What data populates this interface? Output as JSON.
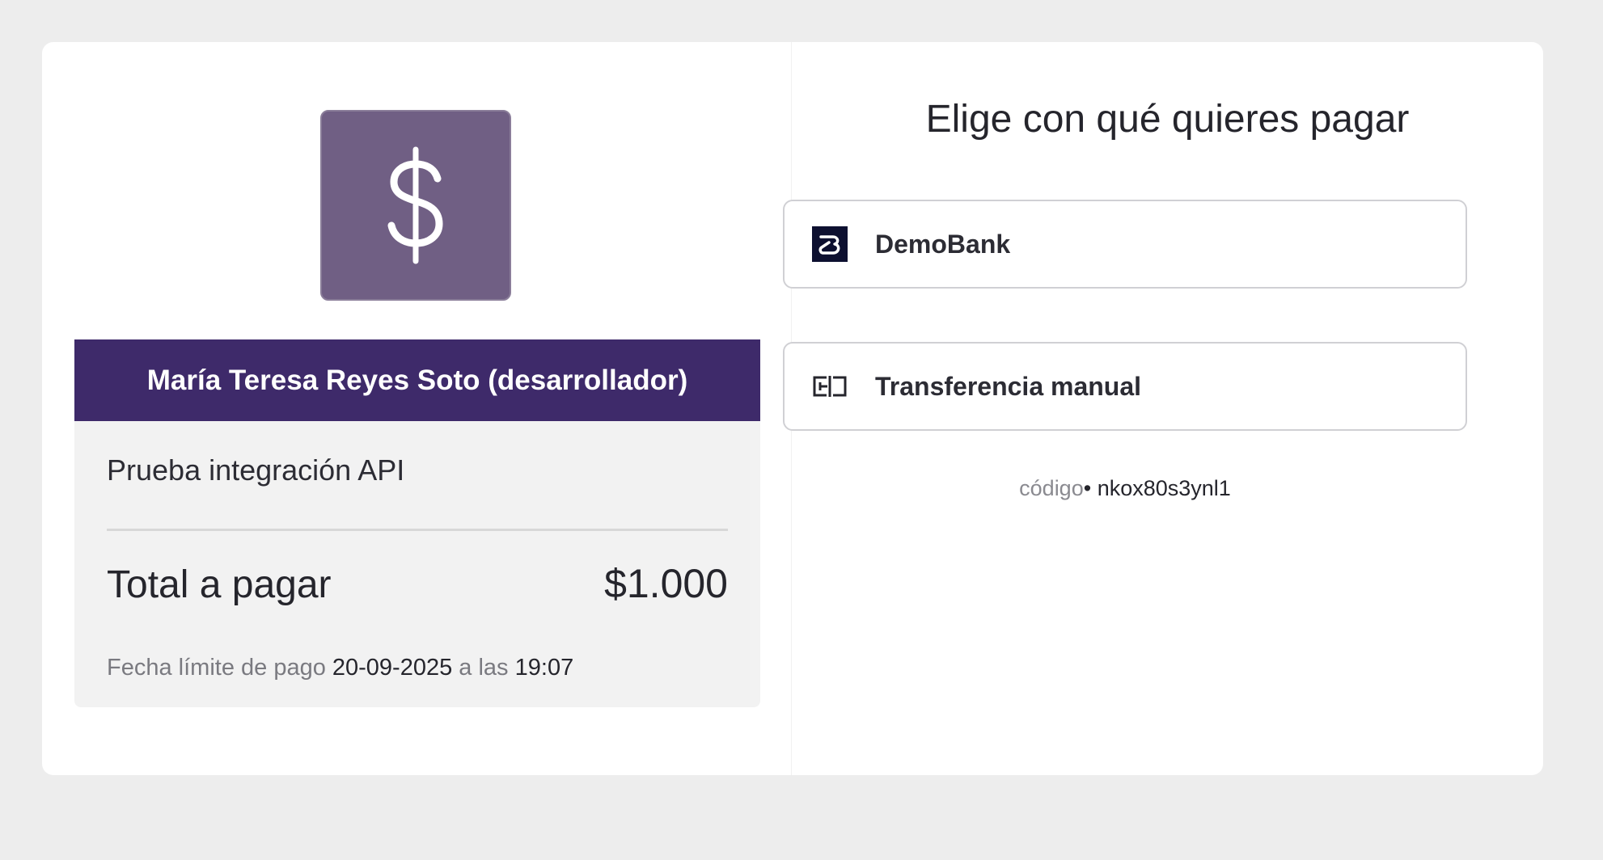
{
  "merchant": {
    "logo_icon": "dollar-sign-icon",
    "logo_color": "#705f84",
    "name": "María Teresa Reyes Soto (desarrollador)",
    "name_bar_color": "#3e2a6a"
  },
  "summary": {
    "description": "Prueba integración API",
    "total_label": "Total a pagar",
    "total_amount": "$1.000",
    "due_prefix": "Fecha límite de pago",
    "due_date": "20-09-2025",
    "due_middle": "a las",
    "due_time": "19:07"
  },
  "payment": {
    "heading": "Elige con qué quieres pagar",
    "methods": [
      {
        "label": "DemoBank",
        "icon": "demobank-logo-icon"
      },
      {
        "label": "Transferencia manual",
        "icon": "transfer-icon"
      }
    ],
    "code_label": "código",
    "code_separator": "•",
    "code_value": "nkox80s3ynl1"
  }
}
